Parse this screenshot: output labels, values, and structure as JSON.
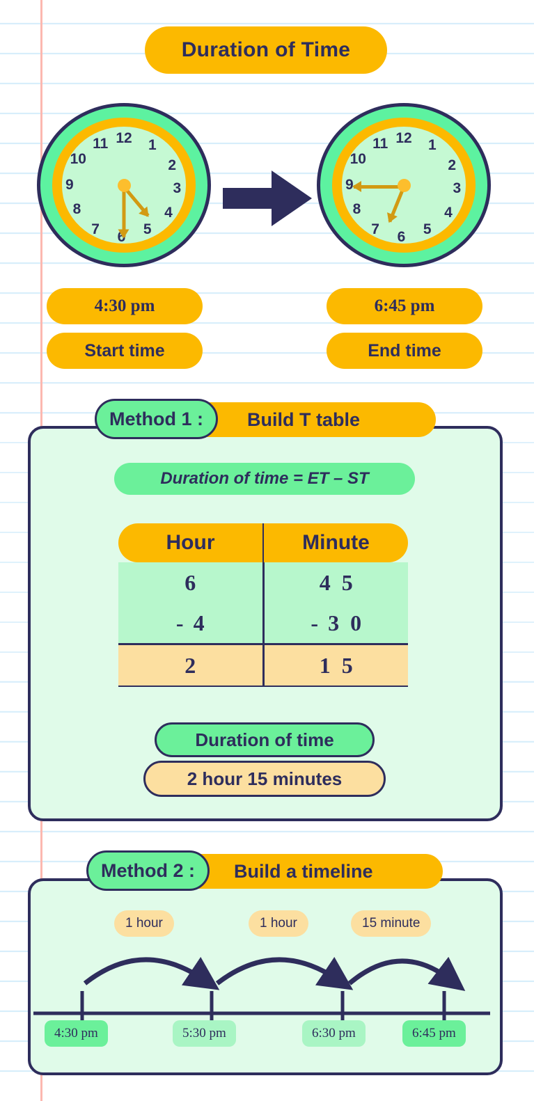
{
  "title": "Duration of Time",
  "clocks": [
    {
      "name": "start",
      "time_label": "4:30 pm",
      "role_label": "Start time",
      "hour_hand_deg": 135,
      "minute_hand_deg": 180,
      "numerals": [
        "12",
        "1",
        "2",
        "3",
        "4",
        "5",
        "6",
        "7",
        "8",
        "9",
        "10",
        "11"
      ]
    },
    {
      "name": "end",
      "time_label": "6:45 pm",
      "role_label": "End time",
      "hour_hand_deg": 202,
      "minute_hand_deg": 270,
      "numerals": [
        "12",
        "1",
        "2",
        "3",
        "4",
        "5",
        "6",
        "7",
        "8",
        "9",
        "10",
        "11"
      ]
    }
  ],
  "method1": {
    "tag": "Method 1 :",
    "heading": "Build T table",
    "formula": "Duration of time = ET – ST",
    "table": {
      "headers": [
        "Hour",
        "Minute"
      ],
      "rows": [
        {
          "hour": "6",
          "minute_tens": "4",
          "minute_ones": "5",
          "operator": ""
        },
        {
          "hour": "4",
          "minute_tens": "3",
          "minute_ones": "0",
          "operator": "-"
        }
      ],
      "result": {
        "hour": "2",
        "minute_tens": "1",
        "minute_ones": "5"
      }
    },
    "result_label": "Duration of time",
    "result_value": "2 hour 15 minutes"
  },
  "method2": {
    "tag": "Method 2 :",
    "heading": "Build a timeline",
    "jumps": [
      "1 hour",
      "1 hour",
      "15 minute"
    ],
    "ticks": [
      "4:30 pm",
      "5:30 pm",
      "6:30 pm",
      "6:45 pm"
    ]
  },
  "colors": {
    "navy": "#2e2d5c",
    "amber": "#fcb900",
    "green": "#6bf09a",
    "mint": "#c5f9d3",
    "peach": "#fcdfa0",
    "panel": "#e0fbe9",
    "hand": "#d29a13"
  }
}
